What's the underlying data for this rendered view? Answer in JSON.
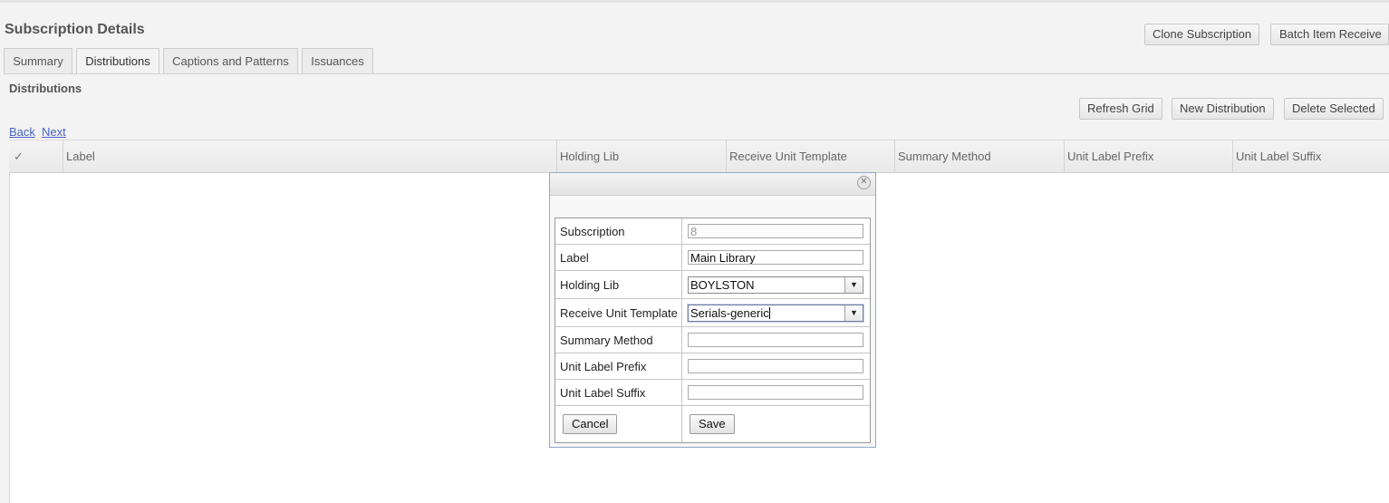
{
  "page": {
    "title": "Subscription Details"
  },
  "actions": {
    "clone_label": "Clone Subscription",
    "batch_receive_label": "Batch Item Receive"
  },
  "tabs": [
    {
      "label": "Summary",
      "active": false
    },
    {
      "label": "Distributions",
      "active": true
    },
    {
      "label": "Captions and Patterns",
      "active": false
    },
    {
      "label": "Issuances",
      "active": false
    }
  ],
  "section": {
    "title": "Distributions"
  },
  "toolbar": {
    "refresh_label": "Refresh Grid",
    "new_label": "New Distribution",
    "delete_label": "Delete Selected"
  },
  "pager": {
    "back_label": "Back",
    "next_label": "Next"
  },
  "grid": {
    "select_icon": "✓",
    "columns": [
      "Label",
      "Holding Lib",
      "Receive Unit Template",
      "Summary Method",
      "Unit Label Prefix",
      "Unit Label Suffix"
    ]
  },
  "dialog": {
    "close_icon": "close-icon",
    "fields": {
      "subscription": {
        "label": "Subscription",
        "value": "8"
      },
      "label": {
        "label": "Label",
        "value": "Main Library"
      },
      "holding_lib": {
        "label": "Holding Lib",
        "value": "BOYLSTON"
      },
      "receive_unit_template": {
        "label": "Receive Unit Template",
        "value": "Serials-generic"
      },
      "summary_method": {
        "label": "Summary Method",
        "value": ""
      },
      "unit_label_prefix": {
        "label": "Unit Label Prefix",
        "value": ""
      },
      "unit_label_suffix": {
        "label": "Unit Label Suffix",
        "value": ""
      }
    },
    "cancel_label": "Cancel",
    "save_label": "Save"
  },
  "colors": {
    "link": "#4a62c6",
    "dialog_border": "#8fa8c8"
  }
}
